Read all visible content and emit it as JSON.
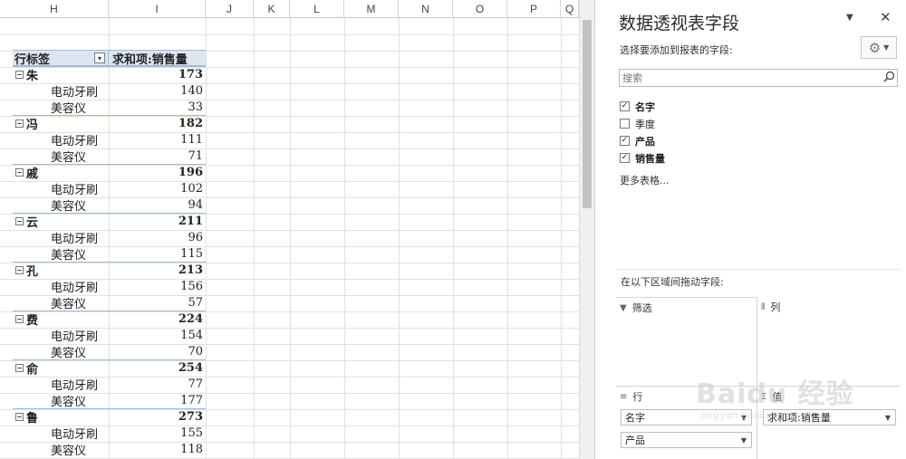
{
  "sheet": {
    "columns": [
      "H",
      "I",
      "J",
      "K",
      "L",
      "M",
      "N",
      "O",
      "P",
      "Q"
    ],
    "pivot": {
      "header_label": "行标签",
      "header_value": "求和项:销售量",
      "filter_icon": "filter-dropdown-icon",
      "groups": [
        {
          "name": "朱",
          "total": "173",
          "items": [
            {
              "name": "电动牙刷",
              "value": "140"
            },
            {
              "name": "美容仪",
              "value": "33"
            }
          ]
        },
        {
          "name": "冯",
          "total": "182",
          "items": [
            {
              "name": "电动牙刷",
              "value": "111"
            },
            {
              "name": "美容仪",
              "value": "71"
            }
          ]
        },
        {
          "name": "戚",
          "total": "196",
          "items": [
            {
              "name": "电动牙刷",
              "value": "102"
            },
            {
              "name": "美容仪",
              "value": "94"
            }
          ]
        },
        {
          "name": "云",
          "total": "211",
          "items": [
            {
              "name": "电动牙刷",
              "value": "96"
            },
            {
              "name": "美容仪",
              "value": "115"
            }
          ]
        },
        {
          "name": "孔",
          "total": "213",
          "items": [
            {
              "name": "电动牙刷",
              "value": "156"
            },
            {
              "name": "美容仪",
              "value": "57"
            }
          ]
        },
        {
          "name": "费",
          "total": "224",
          "items": [
            {
              "name": "电动牙刷",
              "value": "154"
            },
            {
              "name": "美容仪",
              "value": "70"
            }
          ]
        },
        {
          "name": "俞",
          "total": "254",
          "items": [
            {
              "name": "电动牙刷",
              "value": "77"
            },
            {
              "name": "美容仪",
              "value": "177"
            }
          ]
        },
        {
          "name": "鲁",
          "total": "273",
          "items": [
            {
              "name": "电动牙刷",
              "value": "155"
            },
            {
              "name": "美容仪",
              "value": "118"
            }
          ]
        }
      ]
    }
  },
  "pane": {
    "title": "数据透视表字段",
    "menu_glyph": "▼",
    "close_glyph": "✕",
    "subtitle": "选择要添加到报表的字段:",
    "search_placeholder": "搜索",
    "fields": [
      {
        "label": "名字",
        "checked": true
      },
      {
        "label": "季度",
        "checked": false
      },
      {
        "label": "产品",
        "checked": true
      },
      {
        "label": "销售量",
        "checked": true
      }
    ],
    "more_tables": "更多表格...",
    "areas_hint": "在以下区域间拖动字段:",
    "areas": {
      "filter": {
        "label": "筛选",
        "icon": "filter-icon"
      },
      "columns": {
        "label": "列",
        "icon": "columns-icon"
      },
      "rows": {
        "label": "行",
        "icon": "rows-icon",
        "chips": [
          "名字",
          "产品"
        ]
      },
      "values": {
        "label": "值",
        "icon": "sigma-icon",
        "chips": [
          "求和项:销售量"
        ]
      }
    }
  },
  "watermark": {
    "big": "Baidu 经验",
    "small": "jingyan.baidu.com"
  }
}
